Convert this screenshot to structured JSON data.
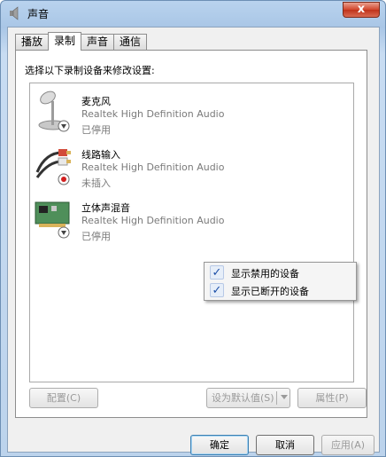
{
  "window": {
    "title": "声音",
    "close_label": "x"
  },
  "tabs": [
    {
      "label": "播放"
    },
    {
      "label": "录制",
      "active": true
    },
    {
      "label": "声音"
    },
    {
      "label": "通信"
    }
  ],
  "instruction": "选择以下录制设备来修改设置:",
  "devices": [
    {
      "name": "麦克风",
      "driver": "Realtek High Definition Audio",
      "status": "已停用",
      "icon": "microphone-icon",
      "badge": "disabled-badge-icon"
    },
    {
      "name": "线路输入",
      "driver": "Realtek High Definition Audio",
      "status": "未插入",
      "icon": "line-in-cable-icon",
      "badge": "unplugged-badge-icon"
    },
    {
      "name": "立体声混音",
      "driver": "Realtek High Definition Audio",
      "status": "已停用",
      "icon": "sound-card-icon",
      "badge": "disabled-badge-icon"
    }
  ],
  "context_menu": [
    {
      "label": "显示禁用的设备",
      "checked": true
    },
    {
      "label": "显示已断开的设备",
      "checked": true
    }
  ],
  "buttons": {
    "configure": "配置(C)",
    "set_default": "设为默认值(S)",
    "properties": "属性(P)",
    "ok": "确定",
    "cancel": "取消",
    "apply": "应用(A)"
  },
  "colors": {
    "check": "#1c4fa8",
    "disabled_text": "#9a9a9a",
    "close_red": "#c0321a"
  }
}
